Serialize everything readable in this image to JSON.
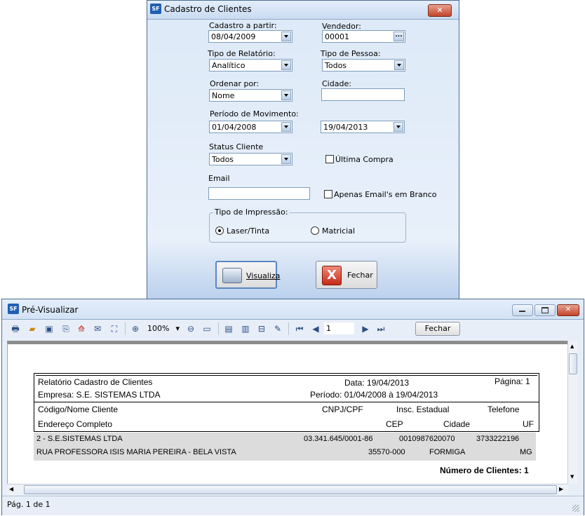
{
  "dialog": {
    "title": "Cadastro de Clientes",
    "logo": "SF",
    "labels": {
      "cadastro": "Cadastro a partir:",
      "vendedor": "Vendedor:",
      "tipo_relatorio": "Tipo de Relatório:",
      "tipo_pessoa": "Tipo de Pessoa:",
      "ordenar": "Ordenar por:",
      "cidade": "Cidade:",
      "periodo": "Período de Movimento:",
      "status": "Status Cliente",
      "email": "Email",
      "ultima_compra": "Última Compra",
      "apenas_emails": "Apenas Email's em Branco",
      "tipo_impressao": "Tipo de Impressão:",
      "laser": "Laser/Tinta",
      "matricial": "Matricial"
    },
    "values": {
      "cadastro": "08/04/2009",
      "vendedor": "00001",
      "tipo_relatorio": "Analítico",
      "tipo_pessoa": "Todos",
      "ordenar": "Nome",
      "cidade": "",
      "periodo_inicio": "01/04/2008",
      "periodo_fim": "19/04/2013",
      "status": "Todos",
      "email": ""
    },
    "buttons": {
      "visualiza": "Visualiza",
      "fechar": "Fechar"
    }
  },
  "preview": {
    "title": "Pré-Visualizar",
    "zoom": "100%",
    "page_number": "1",
    "fechar": "Fechar",
    "status": "Pág. 1 de 1",
    "report": {
      "title": "Relatório Cadastro de Clientes",
      "empresa": "Empresa: S.E. SISTEMAS LTDA",
      "data": "Data: 19/04/2013",
      "periodo": "Período: 01/04/2008 à 19/04/2013",
      "pagina": "Página: 1",
      "headers": {
        "codigo_nome": "Código/Nome Cliente",
        "cnpj": "CNPJ/CPF",
        "insc": "Insc. Estadual",
        "telefone": "Telefone",
        "endereco": "Endereço Completo",
        "cep": "CEP",
        "cidade": "Cidade",
        "uf": "UF"
      },
      "row": {
        "nome": "2 - S.E.SISTEMAS LTDA",
        "cnpj": "03.341.645/0001-86",
        "insc": "0010987620070",
        "telefone": "3733222196",
        "endereco": "RUA PROFESSORA ISIS MARIA PEREIRA - BELA VISTA",
        "cep": "35570-000",
        "cidade": "FORMIGA",
        "uf": "MG"
      },
      "total": "Número de Clientes: 1"
    }
  }
}
